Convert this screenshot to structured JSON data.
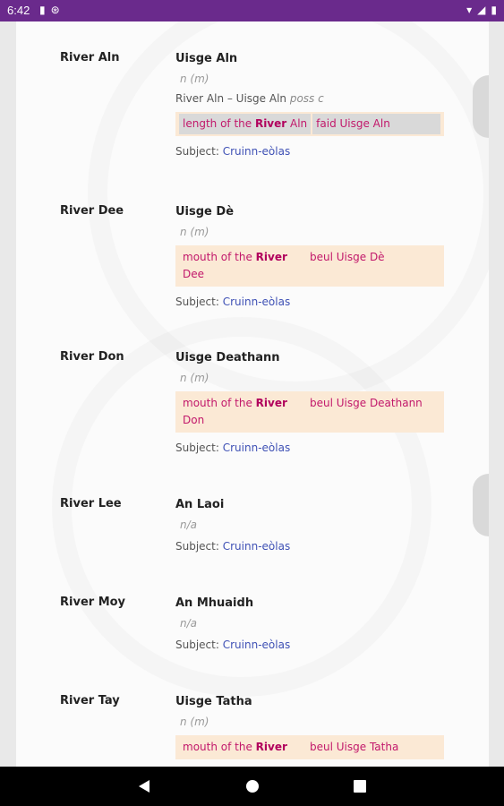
{
  "status_bar": {
    "time": "6:42",
    "left_icons": [
      "sd-card-icon",
      "sync-icon"
    ],
    "right_icons": [
      "wifi-icon",
      "signal-icon",
      "battery-icon"
    ]
  },
  "entries": [
    {
      "headword": "River Aln",
      "translation": "Uisge Aln",
      "grammar": "n  (m)",
      "phrase": "River Aln – Uisge Aln",
      "phrase_note": "poss c",
      "example_en_pre": "length of the ",
      "example_en_bold": "River",
      "example_en_post": " Aln",
      "example_ga": "faid Uisge Aln",
      "subject_label": "Subject:",
      "subject_link": "Cruinn-eòlas"
    },
    {
      "headword": "River Dee",
      "translation": "Uisge Dè",
      "grammar": "n  (m)",
      "example_en_pre": "mouth of the ",
      "example_en_bold": "River",
      "example_en_post": " Dee",
      "example_ga": "beul Uisge Dè",
      "subject_label": "Subject:",
      "subject_link": "Cruinn-eòlas"
    },
    {
      "headword": "River Don",
      "translation": "Uisge Deathann",
      "grammar": "n  (m)",
      "example_en_pre": "mouth of the ",
      "example_en_bold": "River",
      "example_en_post": " Don",
      "example_ga": "beul Uisge Deathann",
      "subject_label": "Subject:",
      "subject_link": "Cruinn-eòlas"
    },
    {
      "headword": "River Lee",
      "translation": "An Laoi",
      "grammar": "n/a",
      "subject_label": "Subject:",
      "subject_link": "Cruinn-eòlas"
    },
    {
      "headword": "River Moy",
      "translation": "An Mhuaidh",
      "grammar": "n/a",
      "subject_label": "Subject:",
      "subject_link": "Cruinn-eòlas"
    },
    {
      "headword": "River Tay",
      "translation": "Uisge Tatha",
      "grammar": "n  (m)",
      "example_en_pre": "mouth of the ",
      "example_en_bold": "River",
      "example_ga": "beul Uisge Tatha"
    }
  ],
  "nav": {
    "back": "back-icon",
    "home": "home-icon",
    "recents": "recents-icon"
  }
}
